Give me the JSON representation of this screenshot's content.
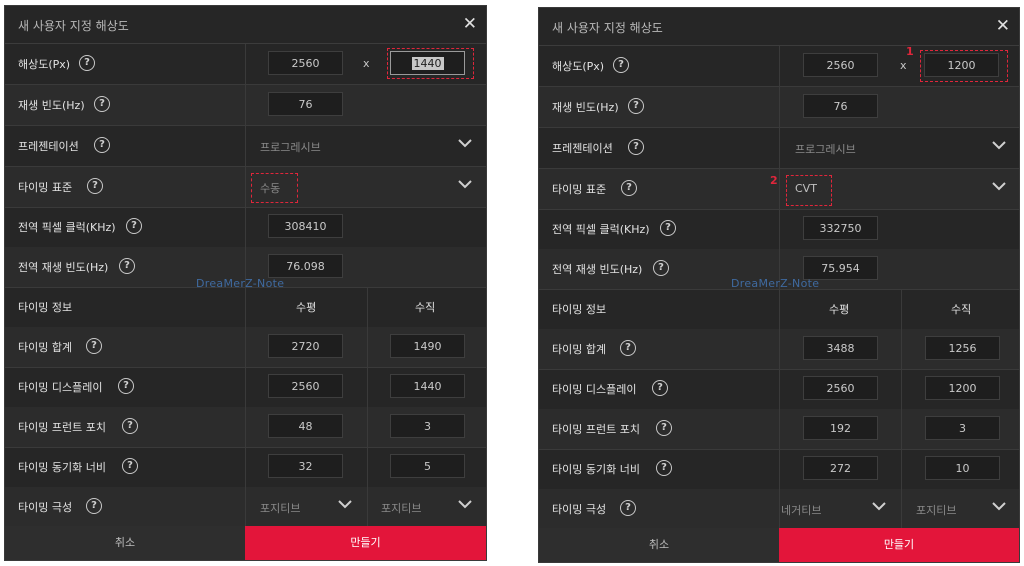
{
  "watermark": "DreaMerZ-Note",
  "left": {
    "title": "새 사용자 지정 해상도",
    "resolution_label": "해상도(Px)",
    "width": "2560",
    "times": "x",
    "height": "1440",
    "refresh_label": "재생 빈도(Hz)",
    "refresh": "76",
    "presentation_label": "프레젠테이션",
    "presentation": "프로그레시브",
    "timing_standard_label": "타이밍 표준",
    "timing_standard": "수동",
    "pixel_clock_label": "전역 픽셀 클럭(KHz)",
    "pixel_clock": "308410",
    "global_refresh_label": "전역 재생 빈도(Hz)",
    "global_refresh": "76.098",
    "timing_info_label": "타이밍 정보",
    "horizontal": "수평",
    "vertical": "수직",
    "total_label": "타이밍 합계",
    "total_h": "2720",
    "total_v": "1490",
    "display_label": "타이밍 디스플레이",
    "display_h": "2560",
    "display_v": "1440",
    "front_porch_label": "타이밍 프런트 포치",
    "front_porch_h": "48",
    "front_porch_v": "3",
    "sync_width_label": "타이밍 동기화 너비",
    "sync_width_h": "32",
    "sync_width_v": "5",
    "polarity_label": "타이밍 극성",
    "polarity_h": "포지티브",
    "polarity_v": "포지티브",
    "cancel": "취소",
    "create": "만들기"
  },
  "right": {
    "title": "새 사용자 지정 해상도",
    "resolution_label": "해상도(Px)",
    "width": "2560",
    "times": "x",
    "height": "1200",
    "refresh_label": "재생 빈도(Hz)",
    "refresh": "76",
    "presentation_label": "프레젠테이션",
    "presentation": "프로그레시브",
    "timing_standard_label": "타이밍 표준",
    "timing_standard": "CVT",
    "pixel_clock_label": "전역 픽셀 클럭(KHz)",
    "pixel_clock": "332750",
    "global_refresh_label": "전역 재생 빈도(Hz)",
    "global_refresh": "75.954",
    "timing_info_label": "타이밍 정보",
    "horizontal": "수평",
    "vertical": "수직",
    "total_label": "타이밍 합계",
    "total_h": "3488",
    "total_v": "1256",
    "display_label": "타이밍 디스플레이",
    "display_h": "2560",
    "display_v": "1200",
    "front_porch_label": "타이밍 프런트 포치",
    "front_porch_h": "192",
    "front_porch_v": "3",
    "sync_width_label": "타이밍 동기화 너비",
    "sync_width_h": "272",
    "sync_width_v": "10",
    "polarity_label": "타이밍 극성",
    "polarity_h": "네거티브",
    "polarity_v": "포지티브",
    "cancel": "취소",
    "create": "만들기",
    "marker_1": "1",
    "marker_2": "2"
  }
}
